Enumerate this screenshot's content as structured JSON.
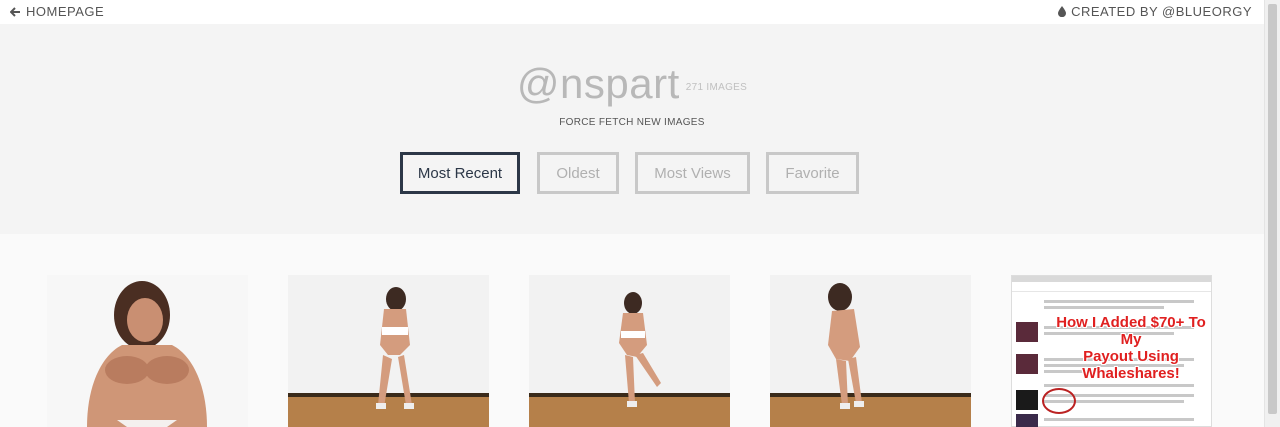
{
  "topbar": {
    "home_label": "HOMEPAGE",
    "credit_label": "CREATED BY @BLUEORGY",
    "home_icon": "arrow-left-icon",
    "credit_icon": "droplet-icon"
  },
  "profile": {
    "username": "@nspart",
    "image_count": "271 IMAGES",
    "force_fetch_label": "FORCE FETCH NEW IMAGES"
  },
  "sort": {
    "most_recent": "Most Recent",
    "oldest": "Oldest",
    "most_views": "Most Views",
    "favorite": "Favorite",
    "active": "Most Recent"
  },
  "gallery": {
    "promo": {
      "headline_line1": "How I Added $70+ To My",
      "headline_line2": "Payout Using Whaleshares!"
    }
  },
  "colors": {
    "active_border": "#2c3747",
    "inactive_border": "#c8c8c8",
    "promo_red": "#e02020"
  }
}
